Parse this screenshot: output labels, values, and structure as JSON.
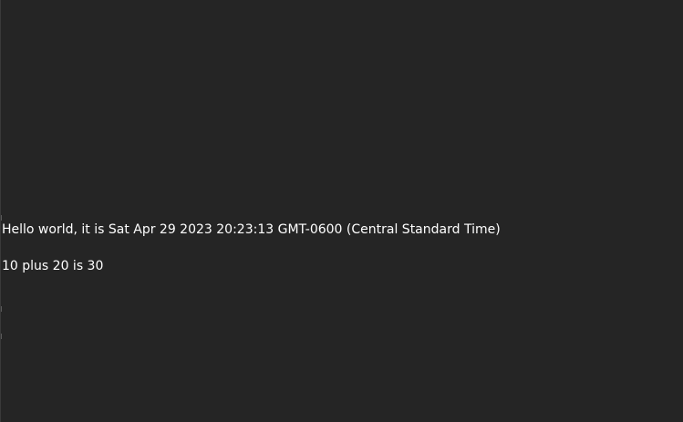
{
  "output": {
    "line1": "Hello world, it is Sat Apr 29 2023 20:23:13 GMT-0600 (Central Standard Time)",
    "line2": "10 plus 20 is 30"
  },
  "colors": {
    "background": "#252525",
    "text": "#ffffff"
  }
}
